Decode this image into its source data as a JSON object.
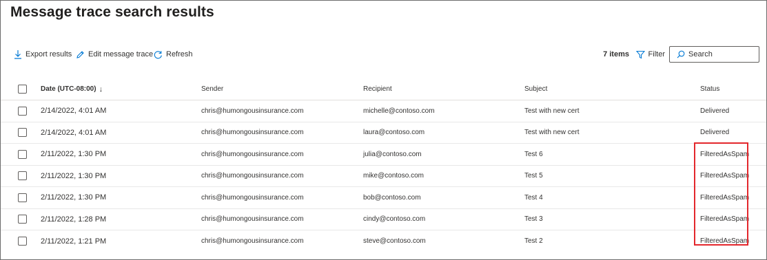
{
  "page": {
    "title": "Message trace search results"
  },
  "toolbar": {
    "export_label": "Export results",
    "edit_label": "Edit message trace",
    "refresh_label": "Refresh",
    "items_count": "7 items",
    "filter_label": "Filter",
    "search_placeholder": "Search",
    "search_value": ""
  },
  "table": {
    "headers": {
      "date": "Date (UTC-08:00)",
      "sender": "Sender",
      "recipient": "Recipient",
      "subject": "Subject",
      "status": "Status"
    },
    "sort_indicator": "↓",
    "rows": [
      {
        "date": "2/14/2022, 4:01 AM",
        "sender": "chris@humongousinsurance.com",
        "recipient": "michelle@contoso.com",
        "subject": "Test with new cert",
        "status": "Delivered"
      },
      {
        "date": "2/14/2022, 4:01 AM",
        "sender": "chris@humongousinsurance.com",
        "recipient": "laura@contoso.com",
        "subject": "Test with new cert",
        "status": "Delivered"
      },
      {
        "date": "2/11/2022, 1:30 PM",
        "sender": "chris@humongousinsurance.com",
        "recipient": "julia@contoso.com",
        "subject": "Test 6",
        "status": "FilteredAsSpam"
      },
      {
        "date": "2/11/2022, 1:30 PM",
        "sender": "chris@humongousinsurance.com",
        "recipient": "mike@contoso.com",
        "subject": "Test 5",
        "status": "FilteredAsSpam"
      },
      {
        "date": "2/11/2022, 1:30 PM",
        "sender": "chris@humongousinsurance.com",
        "recipient": "bob@contoso.com",
        "subject": "Test 4",
        "status": "FilteredAsSpam"
      },
      {
        "date": "2/11/2022, 1:28 PM",
        "sender": "chris@humongousinsurance.com",
        "recipient": "cindy@contoso.com",
        "subject": "Test 3",
        "status": "FilteredAsSpam"
      },
      {
        "date": "2/11/2022, 1:21 PM",
        "sender": "chris@humongousinsurance.com",
        "recipient": "steve@contoso.com",
        "subject": "Test 2",
        "status": "FilteredAsSpam"
      }
    ]
  },
  "colors": {
    "accent": "#0078d4",
    "highlight": "#e3262b"
  },
  "icons": {
    "export": "download-icon",
    "edit": "pencil-icon",
    "refresh": "refresh-icon",
    "filter": "filter-icon",
    "search": "search-icon"
  }
}
